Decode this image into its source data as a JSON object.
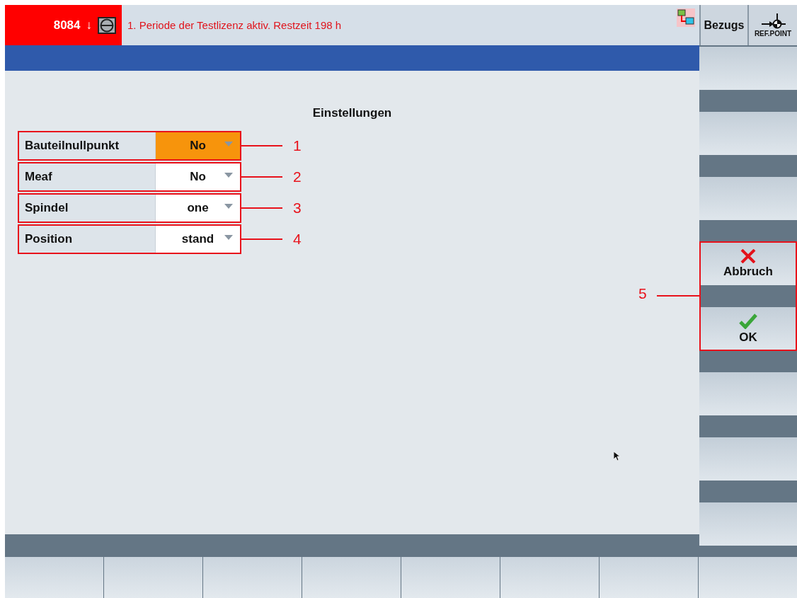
{
  "header": {
    "alarm_number": "8084",
    "alarm_arrow": "↓",
    "message": "1. Periode der Testlizenz aktiv. Restzeit 198 h"
  },
  "top_softkeys": [
    {
      "kind": "text",
      "label": "Bezugs"
    },
    {
      "kind": "refpoint",
      "label": "REF.POINT"
    }
  ],
  "settings": {
    "title": "Einstellungen",
    "rows": [
      {
        "label": "Bauteilnullpunkt",
        "value": "No",
        "selected": true,
        "callout": "1"
      },
      {
        "label": "Meaf",
        "value": "No",
        "selected": false,
        "callout": "2"
      },
      {
        "label": "Spindel",
        "value": "one",
        "selected": false,
        "callout": "3"
      },
      {
        "label": "Position",
        "value": "stand",
        "selected": false,
        "callout": "4"
      }
    ]
  },
  "vertical_softkeys": [
    {
      "kind": "empty"
    },
    {
      "kind": "empty"
    },
    {
      "kind": "empty"
    },
    {
      "kind": "cancel",
      "label": "Abbruch"
    },
    {
      "kind": "confirm",
      "label": "OK"
    },
    {
      "kind": "empty"
    },
    {
      "kind": "empty"
    },
    {
      "kind": "empty"
    }
  ],
  "softkey_callout": "5"
}
